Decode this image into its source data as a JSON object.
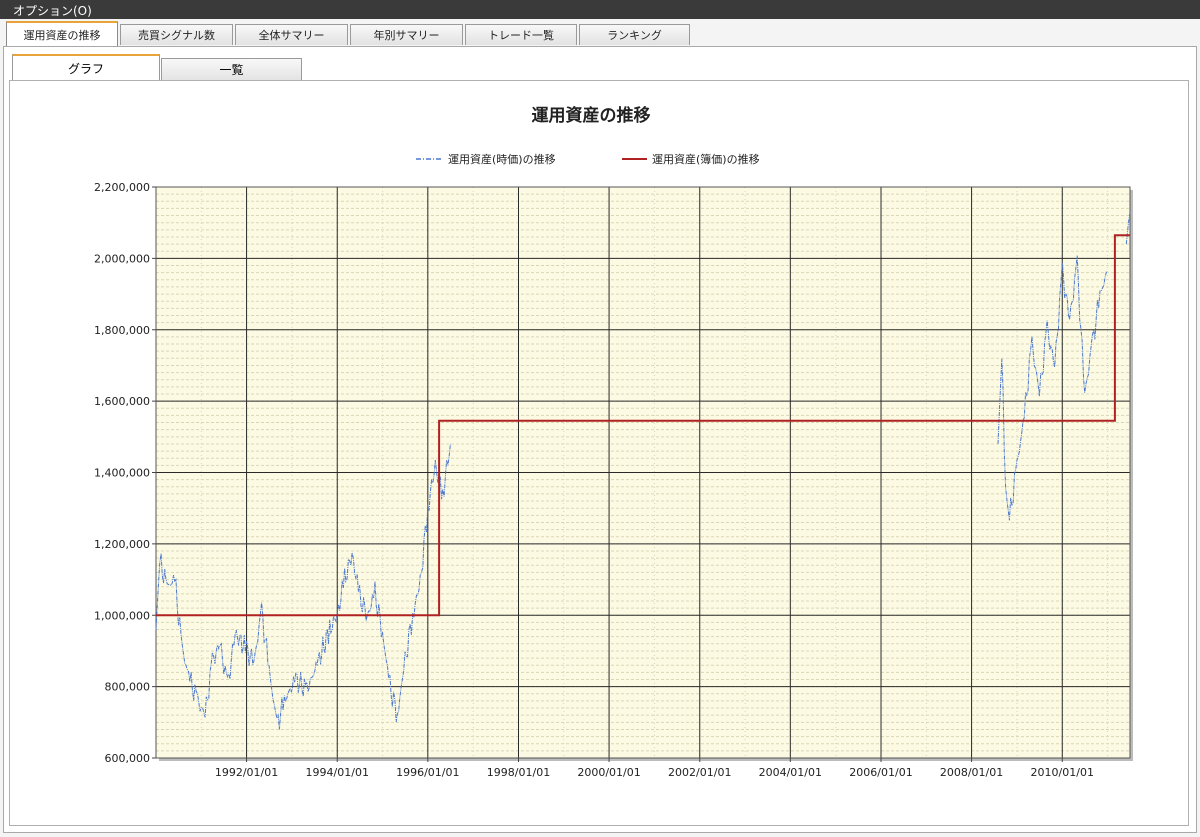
{
  "menubar": {
    "options_label": "オプション(O)"
  },
  "tabs": [
    {
      "label": "運用資産の推移",
      "active": true
    },
    {
      "label": "売買シグナル数",
      "active": false
    },
    {
      "label": "全体サマリー",
      "active": false
    },
    {
      "label": "年別サマリー",
      "active": false
    },
    {
      "label": "トレード一覧",
      "active": false
    },
    {
      "label": "ランキング",
      "active": false
    }
  ],
  "subtabs": [
    {
      "label": "グラフ",
      "active": true
    },
    {
      "label": "一覧",
      "active": false
    }
  ],
  "colors": {
    "plot_background": "#fcfae3",
    "series_market": "#4a78d0",
    "series_book": "#b02222",
    "grid_major": "#2a2a2a",
    "grid_minor": "#d9d6b8"
  },
  "chart_data": {
    "type": "line",
    "title": "運用資産の推移",
    "legend": [
      "運用資産(時価)の推移",
      "運用資産(簿価)の推移"
    ],
    "legend_position": "top-center",
    "grid": true,
    "ylim": [
      600000,
      2200000
    ],
    "xlim": [
      "1990-01-01",
      "2011-07-01"
    ],
    "y_ticks": [
      600000,
      800000,
      1000000,
      1200000,
      1400000,
      1600000,
      1800000,
      2000000,
      2200000
    ],
    "y_tick_labels": [
      "600,000",
      "800,000",
      "1,000,000",
      "1,200,000",
      "1,400,000",
      "1,600,000",
      "1,800,000",
      "2,000,000",
      "2,200,000"
    ],
    "x_ticks": [
      "1992-01-01",
      "1994-01-01",
      "1996-01-01",
      "1998-01-01",
      "2000-01-01",
      "2002-01-01",
      "2004-01-01",
      "2006-01-01",
      "2008-01-01",
      "2010-01-01"
    ],
    "x_tick_labels": [
      "1992/01/01",
      "1994/01/01",
      "1996/01/01",
      "1998/01/01",
      "2000/01/01",
      "2002/01/01",
      "2004/01/01",
      "2006/01/01",
      "2008/01/01",
      "2010/01/01"
    ],
    "series": [
      {
        "name": "運用資産(時価)の推移",
        "style": "dash-dot",
        "segments": [
          [
            [
              "1990-01-01",
              960000
            ],
            [
              "1990-02-01",
              1150000
            ],
            [
              "1990-04-01",
              1080000
            ],
            [
              "1990-06-01",
              1100000
            ],
            [
              "1990-08-01",
              900000
            ],
            [
              "1990-10-01",
              820000
            ],
            [
              "1990-12-01",
              760000
            ],
            [
              "1991-02-01",
              720000
            ],
            [
              "1991-04-01",
              870000
            ],
            [
              "1991-06-01",
              920000
            ],
            [
              "1991-08-01",
              800000
            ],
            [
              "1991-10-01",
              950000
            ],
            [
              "1992-01-01",
              900000
            ],
            [
              "1992-03-01",
              870000
            ],
            [
              "1992-05-01",
              1010000
            ],
            [
              "1992-07-01",
              850000
            ],
            [
              "1992-09-01",
              690000
            ],
            [
              "1992-11-01",
              760000
            ],
            [
              "1993-02-01",
              820000
            ],
            [
              "1993-05-01",
              790000
            ],
            [
              "1993-08-01",
              870000
            ],
            [
              "1993-11-01",
              960000
            ],
            [
              "1994-01-01",
              1000000
            ],
            [
              "1994-03-01",
              1100000
            ],
            [
              "1994-05-01",
              1170000
            ],
            [
              "1994-07-01",
              1050000
            ],
            [
              "1994-09-01",
              1000000
            ],
            [
              "1994-11-01",
              1060000
            ],
            [
              "1995-01-01",
              950000
            ],
            [
              "1995-03-01",
              800000
            ],
            [
              "1995-05-01",
              720000
            ],
            [
              "1995-07-01",
              870000
            ],
            [
              "1995-09-01",
              1000000
            ],
            [
              "1995-11-01",
              1090000
            ],
            [
              "1996-01-01",
              1300000
            ],
            [
              "1996-03-01",
              1420000
            ],
            [
              "1996-05-01",
              1340000
            ],
            [
              "1996-07-01",
              1480000
            ]
          ],
          [
            [
              "2008-08-01",
              1480000
            ],
            [
              "2008-09-01",
              1720000
            ],
            [
              "2008-10-01",
              1350000
            ],
            [
              "2008-11-01",
              1270000
            ],
            [
              "2009-01-01",
              1420000
            ],
            [
              "2009-03-01",
              1560000
            ],
            [
              "2009-05-01",
              1760000
            ],
            [
              "2009-07-01",
              1620000
            ],
            [
              "2009-09-01",
              1800000
            ],
            [
              "2009-11-01",
              1700000
            ],
            [
              "2010-01-01",
              1960000
            ],
            [
              "2010-03-01",
              1830000
            ],
            [
              "2010-05-01",
              1980000
            ],
            [
              "2010-07-01",
              1620000
            ],
            [
              "2010-09-01",
              1760000
            ],
            [
              "2010-11-01",
              1900000
            ],
            [
              "2011-01-01",
              1960000
            ]
          ],
          [
            [
              "2011-06-01",
              2040000
            ],
            [
              "2011-07-01",
              2130000
            ]
          ]
        ]
      },
      {
        "name": "運用資産(簿価)の推移",
        "style": "step",
        "values": [
          [
            "1990-01-01",
            1000000
          ],
          [
            "1996-04-01",
            1000000
          ],
          [
            "1996-04-01",
            1545000
          ],
          [
            "2011-03-01",
            1545000
          ],
          [
            "2011-03-01",
            2065000
          ],
          [
            "2011-07-01",
            2065000
          ]
        ]
      }
    ]
  }
}
